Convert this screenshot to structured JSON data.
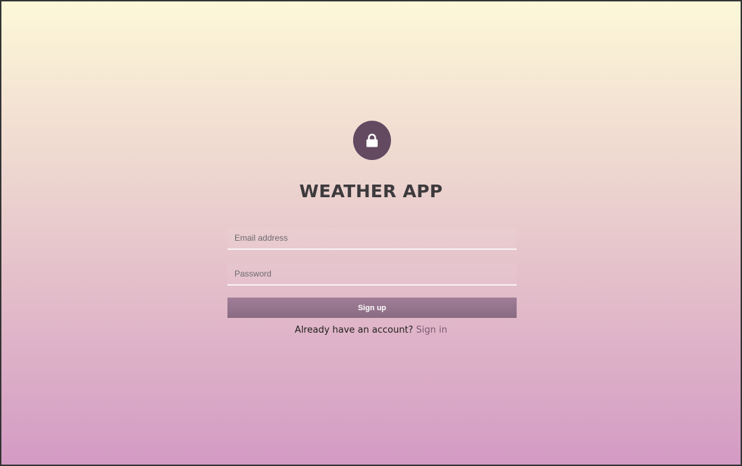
{
  "app": {
    "title": "WEATHER APP"
  },
  "icons": {
    "badge": "lock-icon"
  },
  "form": {
    "email_placeholder": "Email address",
    "email_value": "",
    "password_placeholder": "Password",
    "password_value": "",
    "submit_label": "Sign up"
  },
  "footer": {
    "prompt": "Already have an account?",
    "link_label": "Sign in"
  },
  "colors": {
    "accent": "#634a61",
    "button": "#937288",
    "link": "#7a5a74",
    "gradient_top": "#fdf8d8",
    "gradient_bottom": "#d39bc4"
  }
}
